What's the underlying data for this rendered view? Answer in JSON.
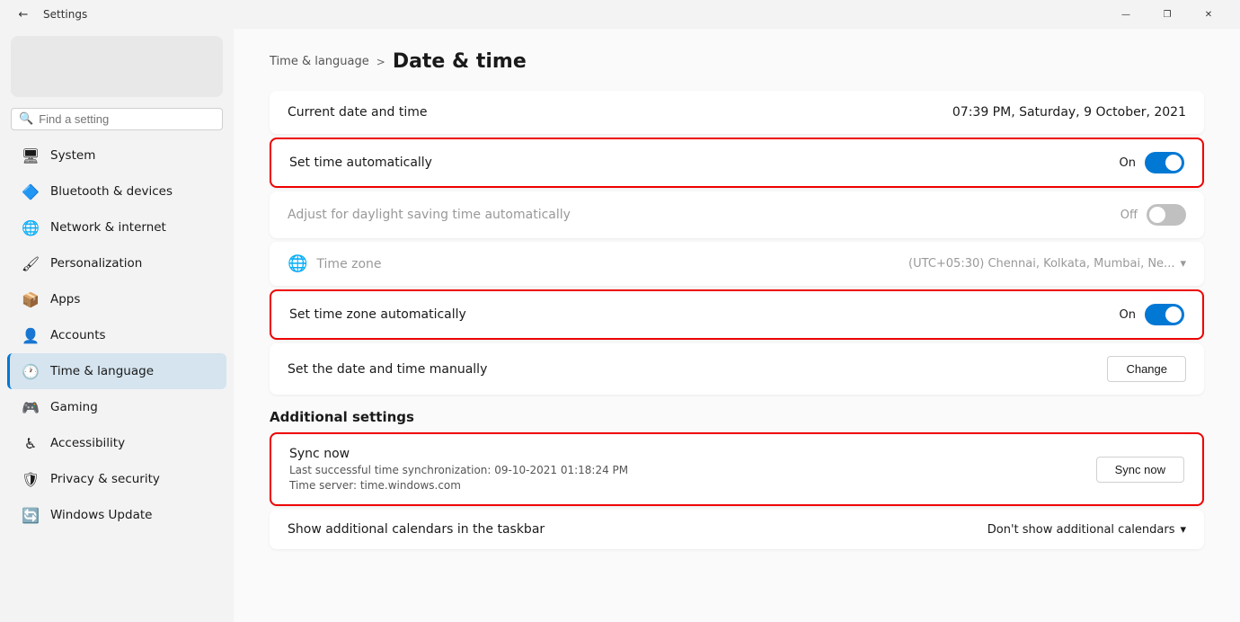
{
  "titlebar": {
    "title": "Settings",
    "minimize": "—",
    "maximize": "❐",
    "close": "✕"
  },
  "sidebar": {
    "search_placeholder": "Find a setting",
    "nav_items": [
      {
        "id": "system",
        "label": "System",
        "icon": "🖥",
        "active": false
      },
      {
        "id": "bluetooth",
        "label": "Bluetooth & devices",
        "icon": "🔷",
        "active": false
      },
      {
        "id": "network",
        "label": "Network & internet",
        "icon": "🌐",
        "active": false
      },
      {
        "id": "personalization",
        "label": "Personalization",
        "icon": "🖌",
        "active": false
      },
      {
        "id": "apps",
        "label": "Apps",
        "icon": "📦",
        "active": false
      },
      {
        "id": "accounts",
        "label": "Accounts",
        "icon": "👤",
        "active": false
      },
      {
        "id": "time-language",
        "label": "Time & language",
        "icon": "🕐",
        "active": true
      },
      {
        "id": "gaming",
        "label": "Gaming",
        "icon": "🎮",
        "active": false
      },
      {
        "id": "accessibility",
        "label": "Accessibility",
        "icon": "♿",
        "active": false
      },
      {
        "id": "privacy-security",
        "label": "Privacy & security",
        "icon": "🛡",
        "active": false
      },
      {
        "id": "windows-update",
        "label": "Windows Update",
        "icon": "🔄",
        "active": false
      }
    ]
  },
  "content": {
    "breadcrumb_parent": "Time & language",
    "breadcrumb_sep": ">",
    "page_title": "Date & time",
    "current_datetime_label": "Current date and time",
    "current_datetime_value": "07:39 PM, Saturday, 9 October, 2021",
    "set_time_auto_label": "Set time automatically",
    "set_time_auto_status": "On",
    "set_time_auto_state": "on",
    "adjust_daylight_label": "Adjust for daylight saving time automatically",
    "adjust_daylight_status": "Off",
    "adjust_daylight_state": "off",
    "timezone_label": "Time zone",
    "timezone_value": "(UTC+05:30) Chennai, Kolkata, Mumbai, Ne...",
    "set_timezone_auto_label": "Set time zone automatically",
    "set_timezone_auto_status": "On",
    "set_timezone_auto_state": "on",
    "set_date_manual_label": "Set the date and time manually",
    "change_btn_label": "Change",
    "additional_settings_title": "Additional settings",
    "sync_now_title": "Sync now",
    "sync_last_success": "Last successful time synchronization: 09-10-2021 01:18:24 PM",
    "sync_time_server": "Time server: time.windows.com",
    "sync_now_btn": "Sync now",
    "show_calendars_label": "Show additional calendars in the taskbar",
    "show_calendars_value": "Don't show additional calendars",
    "chevron_down": "▾"
  }
}
